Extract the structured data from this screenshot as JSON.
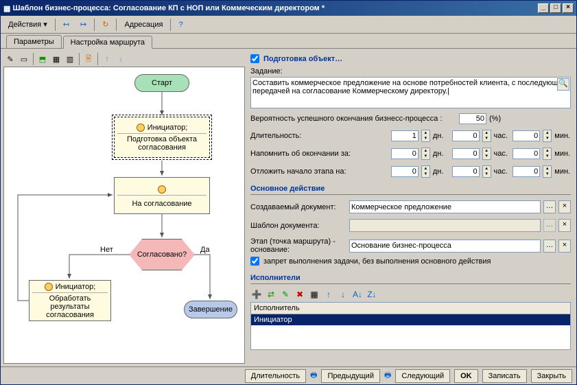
{
  "title": "Шаблон бизнес-процесса: Согласование КП с НОП или Коммеческим директором *",
  "menu": {
    "actions": "Действия ▾",
    "addressing": "Адресация"
  },
  "tabs": {
    "params": "Параметры",
    "route": "Настройка маршрута"
  },
  "flow": {
    "start": "Старт",
    "initiator": "Инициатор;",
    "prepare": "Подготовка объекта согласования",
    "approve": "На согласование",
    "decision": "Согласовано?",
    "no": "Нет",
    "yes": "Да",
    "process": "Обработать результаты согласования",
    "end": "Завершение"
  },
  "form": {
    "prep_cb": "Подготовка объект…",
    "task_l": "Задание:",
    "task_v": "Составить коммерческое предложение на основе потребностей клиента, с последующей передачей на согласование Коммерческому директору.|",
    "prob_l": "Вероятность успешного окончания бизнесс-процесса :",
    "prob_v": "50",
    "prob_u": "(%)",
    "dur_l": "Длительность:",
    "dur_d": "1",
    "dur_h": "0",
    "dur_m": "0",
    "rem_l": "Напомнить об окончании за:",
    "rem_d": "0",
    "rem_h": "0",
    "rem_m": "0",
    "post_l": "Отложить начало этапа на:",
    "post_d": "0",
    "post_h": "0",
    "post_m": "0",
    "u_d": "дн.",
    "u_h": "час.",
    "u_m": "мин.",
    "sect_main": "Основное действие",
    "doc_l": "Создаваемый документ:",
    "doc_v": "Коммерческое предложение",
    "tpl_l": "Шаблон документа:",
    "tpl_v": "",
    "stage_l": "Этап (точка маршрута) - основание:",
    "stage_v": "Основание бизнес-процесса",
    "forbid": "запрет выполнения задачи, без выполнения основного действия",
    "sect_exec": "Исполнители",
    "grid_h": "Исполнитель",
    "grid_r": "Инициатор"
  },
  "footer": {
    "dur": "Длительность",
    "prev": "Предыдущий",
    "next": "Следующий",
    "ok": "OK",
    "save": "Записать",
    "close": "Закрыть"
  }
}
